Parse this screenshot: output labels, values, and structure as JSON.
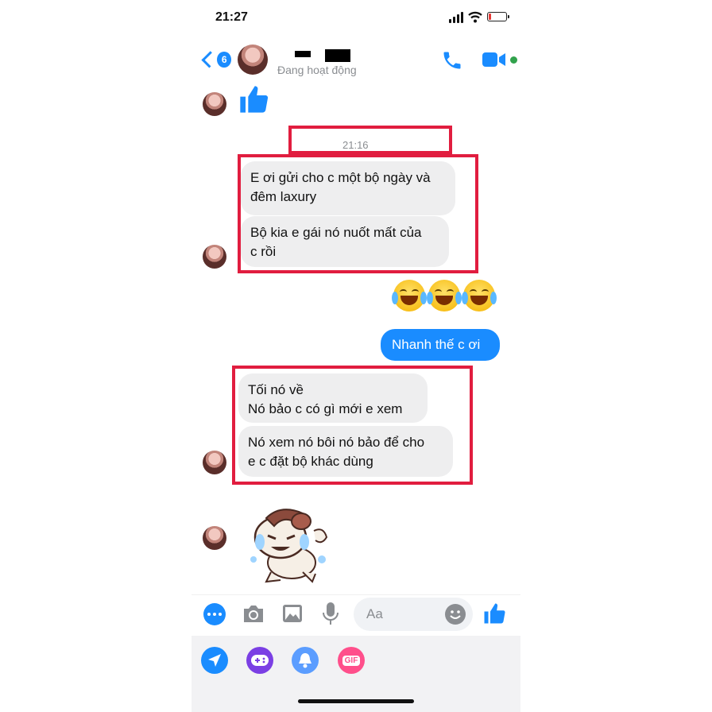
{
  "status_bar": {
    "time": "21:27",
    "battery_color": "#e53935",
    "battery_level": 0.15
  },
  "header": {
    "unread_count": "6",
    "status": "Đang hoạt động",
    "accent": "#1a8cff",
    "active_color": "#31a24c"
  },
  "conversation": {
    "timestamp": "21:16",
    "group1": [
      {
        "text_lines": [
          "E ơi gửi cho c một bộ ngày và",
          "đêm laxury"
        ]
      },
      {
        "text_lines": [
          "Bộ kia e gái nó nuốt mất của",
          "c rồi"
        ]
      }
    ],
    "reaction_emojis": [
      "laughing-with-tears",
      "laughing-with-tears",
      "laughing-with-tears"
    ],
    "outgoing": "Nhanh thế c ơi",
    "group2": [
      {
        "text_lines": [
          "Tối nó về",
          "Nó bảo c có gì mới e xem"
        ]
      },
      {
        "text_lines": [
          "Nó xem nó bôi nó bảo để cho",
          "e c đặt bộ khác dùng"
        ]
      }
    ],
    "sticker": "crying-dog-sticker",
    "highlight_color": "#e11d3f"
  },
  "composer": {
    "placeholder": "Aa"
  },
  "tray": {
    "gif_label": "GIF"
  }
}
